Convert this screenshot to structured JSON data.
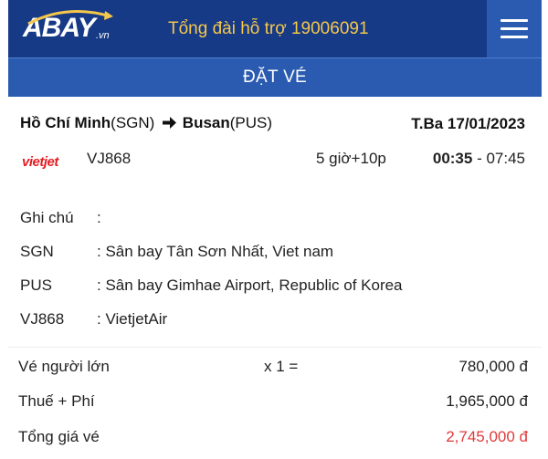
{
  "header": {
    "logo_text": "ABAY.vn",
    "hotline_label": "Tổng đài hỗ trợ",
    "hotline_number": "19006091",
    "menu_icon": "hamburger-menu-icon",
    "colors": {
      "navbar": "#173a86",
      "title_bar": "#2a5bb0",
      "hotline": "#f5c74a"
    }
  },
  "title": "ĐẶT VÉ",
  "flight": {
    "origin_city": "Hồ Chí Minh",
    "origin_code": "(SGN)",
    "destination_city": "Busan",
    "destination_code": "(PUS)",
    "date": "T.Ba 17/01/2023",
    "airline_logo_text": "vietjet",
    "flight_number": "VJ868",
    "duration": "5 giờ+10p",
    "depart_time": "00:35",
    "time_separator": " - ",
    "arrive_time": "07:45"
  },
  "notes": [
    {
      "key": "Ghi chú",
      "value": ":"
    },
    {
      "key": "SGN",
      "value": ": Sân bay Tân Sơn Nhất, Viet nam"
    },
    {
      "key": "PUS",
      "value": ": Sân bay Gimhae Airport, Republic of Korea"
    },
    {
      "key": "VJ868",
      "value": ": VietjetAir"
    }
  ],
  "pricing": {
    "adult_label": "Vé người lớn",
    "adult_qty": "x 1 =",
    "adult_price": "780,000 đ",
    "tax_label": "Thuế + Phí",
    "tax_price": "1,965,000 đ",
    "total_label": "Tổng giá vé",
    "total_price": "2,745,000 đ",
    "total_color": "#e03a3a"
  }
}
